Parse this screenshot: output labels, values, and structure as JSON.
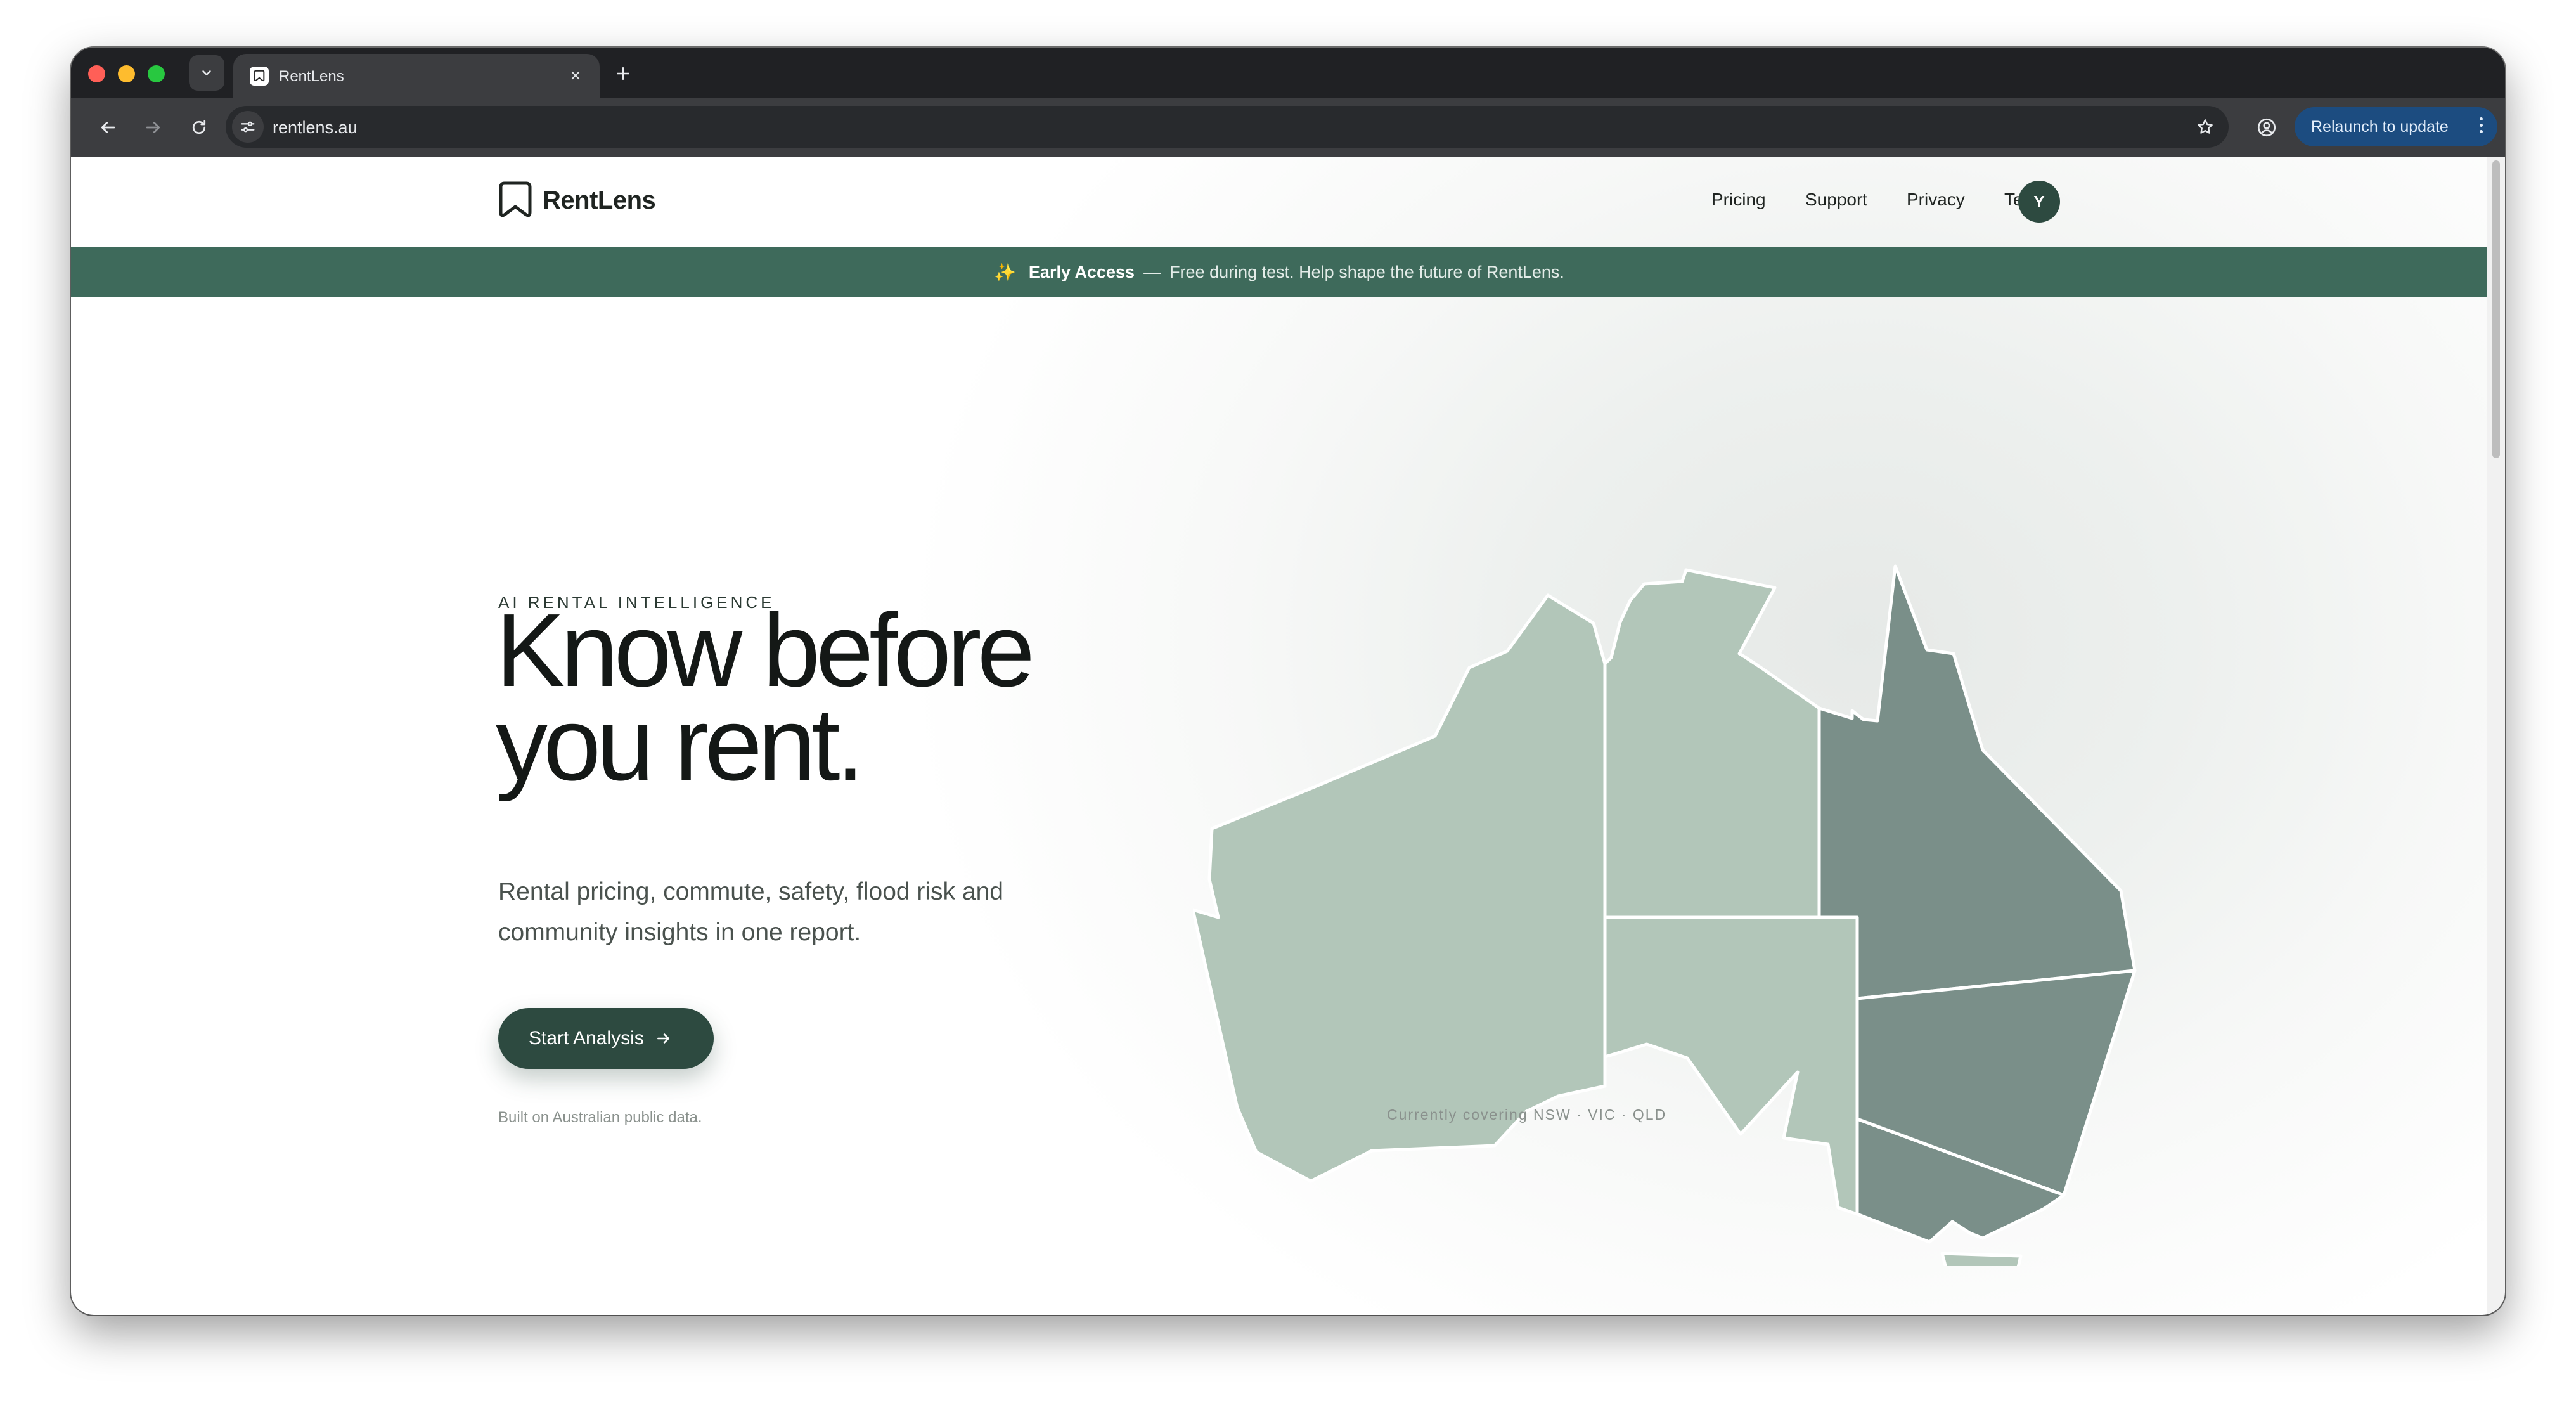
{
  "browser": {
    "tab_title": "RentLens",
    "url": "rentlens.au",
    "relaunch_label": "Relaunch to update",
    "icons": [
      "tab-search-icon",
      "close-icon",
      "plus-icon",
      "back-arrow-icon",
      "forward-arrow-icon",
      "reload-icon",
      "site-settings-icon",
      "star-icon",
      "profile-icon",
      "more-vert-icon"
    ]
  },
  "site": {
    "brand_name": "RentLens",
    "nav": [
      "Pricing",
      "Support",
      "Privacy",
      "Terms"
    ],
    "avatar_initial": "Y"
  },
  "banner": {
    "sparkle": "✨",
    "strong": "Early Access",
    "dash": "—",
    "text": "Free during test. Help shape the future of RentLens."
  },
  "hero": {
    "eyebrow": "AI RENTAL INTELLIGENCE",
    "headline_line1": "Know before",
    "headline_line2": "you rent.",
    "subhead": "Rental pricing, commute, safety, flood risk and community insights in one report.",
    "cta_label": "Start Analysis",
    "footnote": "Built on Australian public data."
  },
  "map": {
    "coverage_label": "Currently covering NSW · VIC · QLD",
    "colors": {
      "covered": "#7a8f89",
      "uncovered": "#b2c6b9",
      "border": "#ffffff"
    }
  },
  "colors": {
    "brand_dark": "#2d4a40",
    "banner": "#3e6a5b",
    "relaunch": "#1c4c80"
  }
}
